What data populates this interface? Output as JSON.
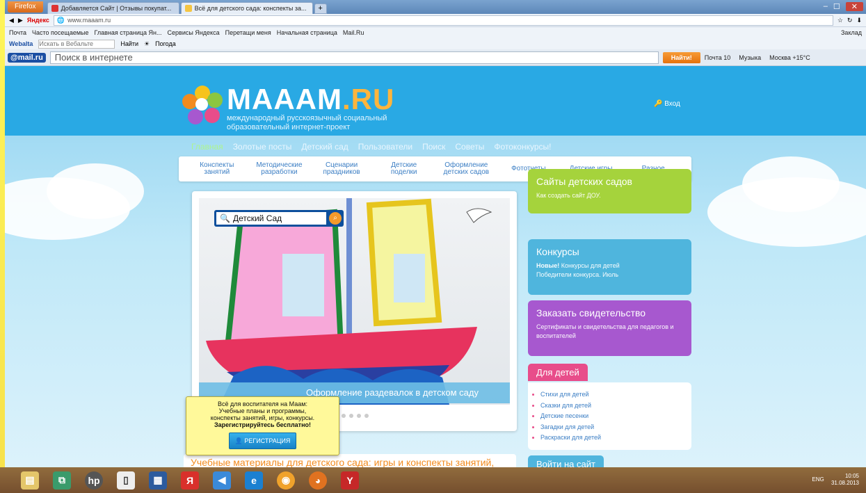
{
  "browser": {
    "app_button": "Firefox",
    "tabs": [
      {
        "label": "Добавляется Сайт | Отзывы покупат...",
        "active": false
      },
      {
        "label": "Всё для детского сада: конспекты за...",
        "active": true
      }
    ],
    "new_tab": "+",
    "window_controls": [
      "–",
      "☐",
      "✕"
    ],
    "yandex_label": "Яндекс",
    "url": "www.maaam.ru",
    "bookmarks": [
      "Почта",
      "Часто посещаемые",
      "Главная страница Ян...",
      "Сервисы Яндекса",
      "Перетащи меня",
      "Начальная страница",
      "Mail.Ru"
    ],
    "bookmarks_right": "Заклад",
    "webalta": {
      "logo": "Webalta",
      "placeholder": "Искать в Вебальте",
      "find": "Найти",
      "weather": "Погода"
    },
    "mailru": {
      "logo": "@mail.ru",
      "search_placeholder": "Поиск в интернете",
      "find_button": "Найти!",
      "extras": [
        "Почта 10",
        "Музыка",
        "Москва +15°C"
      ]
    }
  },
  "site": {
    "logo_title": "MAAAM",
    "logo_suffix": ".RU",
    "logo_subtitle_1": "международный русскоязычный социальный",
    "logo_subtitle_2": "образовательный интернет-проект",
    "login": "Вход",
    "topnav": [
      "Главная",
      "Золотые посты",
      "Детский сад",
      "Пользователи",
      "Поиск",
      "Советы",
      "Фотоконкурсы!"
    ],
    "subnav": [
      {
        "l1": "Конспекты",
        "l2": "занятий"
      },
      {
        "l1": "Методические",
        "l2": "разработки"
      },
      {
        "l1": "Сценарии",
        "l2": "праздников"
      },
      {
        "l1": "Детские",
        "l2": "поделки"
      },
      {
        "l1": "Оформление",
        "l2": "детских садов"
      },
      {
        "l1": "Фототчеты",
        "l2": ""
      },
      {
        "l1": "Детские игры",
        "l2": ""
      },
      {
        "l1": "Разное",
        "l2": ""
      }
    ],
    "slider": {
      "search_value": "Детский Сад",
      "caption": "Оформление раздевалок в детском саду"
    },
    "popup": {
      "line1": "Всё для воспитателя на Маам:",
      "line2": "Учебные планы и программы,",
      "line3": "конспекты занятий, игры, конкурсы.",
      "line4": "Зарегистрируйтесь бесплатно!",
      "button": "РЕГИСТРАЦИЯ"
    },
    "feature_title": "Учебные материалы для детского сада: игры и конспекты занятий, сценарии праздников и поделки на Маам.ру",
    "cards": {
      "sites": {
        "title": "Сайты детских садов",
        "desc": "Как создать сайт ДОУ."
      },
      "contests": {
        "title": "Конкурсы",
        "new": "Новые!",
        "desc": " Конкурсы для детей",
        "desc2": "Победители конкурса. Июль"
      },
      "certificate": {
        "title": "Заказать свидетельство",
        "desc": "Сертификаты и свидетельства для педагогов и воспитателей"
      }
    },
    "kids": {
      "title": "Для детей",
      "items": [
        "Стихи для детей",
        "Сказки для детей",
        "Детские песенки",
        "Загадки для детей",
        "Раскраски для детей"
      ]
    },
    "login_tag": "Войти на сайт"
  },
  "taskbar": {
    "lang": "ENG",
    "time": "10:05",
    "date": "31.08.2013"
  },
  "colors": {
    "header": "#29a9e4",
    "green_card": "#a5d33c",
    "blue_card": "#4fb5dd",
    "purple_card": "#a758cf",
    "pink_tag": "#e84d8a"
  }
}
